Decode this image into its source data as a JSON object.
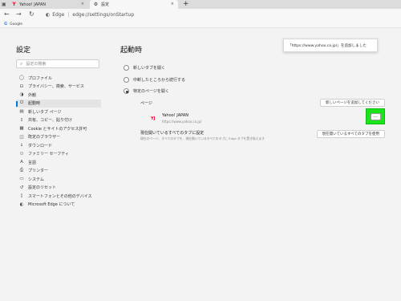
{
  "tabs": [
    {
      "label": "Yahoo! JAPAN",
      "icon": "yahoo-japan-icon",
      "close": "×"
    },
    {
      "label": "設定",
      "icon": "gear-icon",
      "close": "×"
    }
  ],
  "new_tab_label": "+",
  "address": {
    "brand": "Edge",
    "url": "edge://settings/onStartup"
  },
  "favorites": [
    {
      "label": "Google",
      "icon": "google-icon"
    }
  ],
  "sidebar": {
    "title": "設定",
    "search_placeholder": "設定の検索",
    "items": [
      {
        "label": "プロファイル",
        "icon": "person-icon"
      },
      {
        "label": "プライバシー、検索、サービス",
        "icon": "lock-icon"
      },
      {
        "label": "外観",
        "icon": "appearance-icon"
      },
      {
        "label": "起動時",
        "icon": "power-icon"
      },
      {
        "label": "新しいタブ ページ",
        "icon": "new-tab-icon"
      },
      {
        "label": "共有、コピー、貼り付け",
        "icon": "share-icon"
      },
      {
        "label": "Cookie とサイトのアクセス許可",
        "icon": "cookie-icon"
      },
      {
        "label": "既定のブラウザー",
        "icon": "browser-icon"
      },
      {
        "label": "ダウンロード",
        "icon": "download-icon"
      },
      {
        "label": "ファミリー セーフティ",
        "icon": "family-icon"
      },
      {
        "label": "言語",
        "icon": "language-icon"
      },
      {
        "label": "プリンター",
        "icon": "printer-icon"
      },
      {
        "label": "システム",
        "icon": "system-icon"
      },
      {
        "label": "設定のリセット",
        "icon": "reset-icon"
      },
      {
        "label": "スマートフォンとその他のデバイス",
        "icon": "phone-icon"
      },
      {
        "label": "Microsoft Edge について",
        "icon": "edge-icon"
      }
    ],
    "active_index": 3
  },
  "main": {
    "title": "起動時",
    "options": [
      {
        "label": "新しいタブを開く",
        "checked": false
      },
      {
        "label": "中断したところから続行する",
        "checked": false
      },
      {
        "label": "特定のページを開く",
        "checked": true
      }
    ],
    "pages_label": "ページ",
    "add_page_button": "新しいページを追加してください",
    "page_entry": {
      "name": "Yahoo! JAPAN",
      "url": "https://www.yahoo.co.jp/",
      "favicon_text": "YJ"
    },
    "more_actions": "...",
    "current_tabs": {
      "label": "現在開いているすべてのタブに設定",
      "description": "現在のページ、すべてのタブを、現在開いているすべてのタブに Edge タブを置き換えます",
      "button": "現在開いているすべてのタブを使用"
    }
  },
  "toast": {
    "text": "「https://www.yahoo.co.jp/」を追加しました"
  },
  "colors": {
    "accent": "#0078d4",
    "highlight": "#1ae51a",
    "yahoo_red": "#ff0033"
  }
}
